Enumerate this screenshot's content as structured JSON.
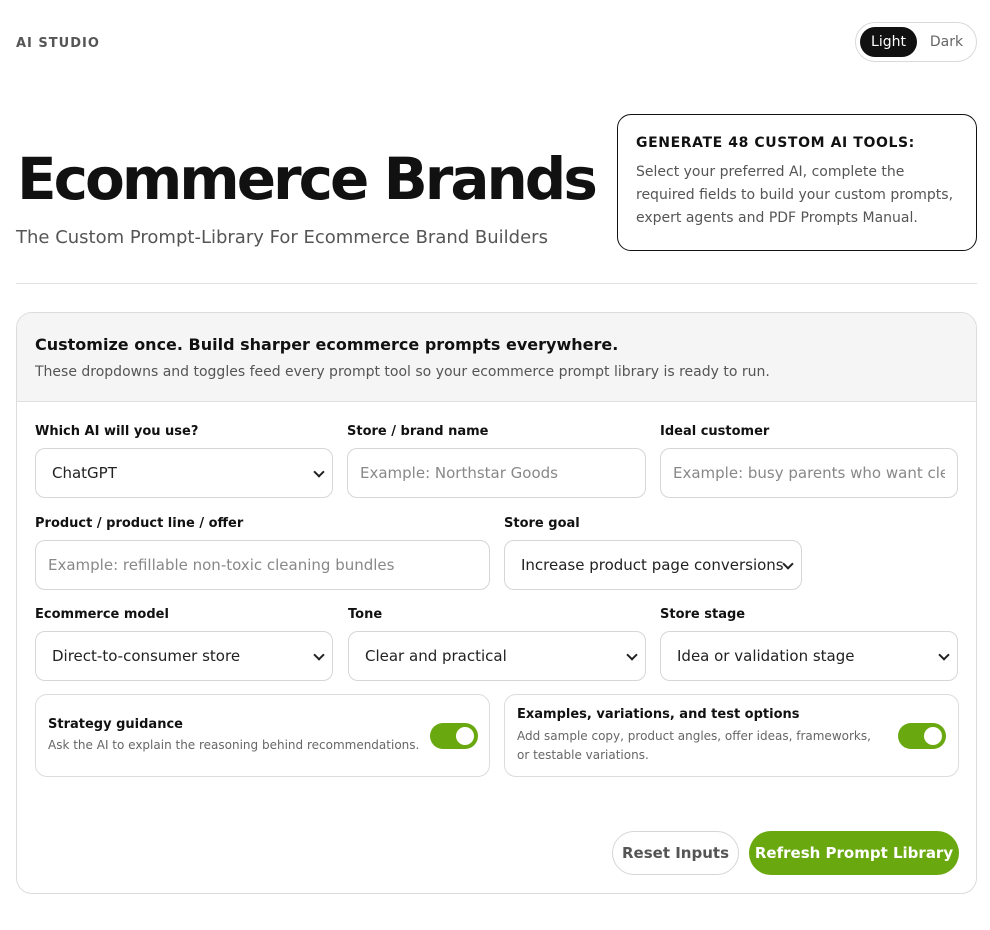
{
  "header": {
    "brand": "AI STUDIO",
    "theme": {
      "light_label": "Light",
      "dark_label": "Dark",
      "selected": "Light"
    }
  },
  "hero": {
    "title": "Ecommerce Brands",
    "subtitle": "The Custom Prompt-Library For Ecommerce Brand Builders"
  },
  "promo": {
    "heading": "GENERATE 48 CUSTOM AI TOOLS:",
    "body": "Select your preferred AI, complete the required fields to build your custom prompts, expert agents and PDF Prompts Manual."
  },
  "panel": {
    "title": "Customize once. Build sharper ecommerce prompts everywhere.",
    "description": "These dropdowns and toggles feed every prompt tool so your ecommerce prompt library is ready to run."
  },
  "form": {
    "ai": {
      "label": "Which AI will you use?",
      "value": "ChatGPT"
    },
    "store_name": {
      "label": "Store / brand name",
      "placeholder": "Example: Northstar Goods",
      "value": ""
    },
    "customer": {
      "label": "Ideal customer",
      "placeholder": "Example: busy parents who want clean",
      "value": ""
    },
    "product": {
      "label": "Product / product line / offer",
      "placeholder": "Example: refillable non-toxic cleaning bundles",
      "value": ""
    },
    "goal": {
      "label": "Store goal",
      "value": "Increase product page conversions"
    },
    "model": {
      "label": "Ecommerce model",
      "value": "Direct-to-consumer store"
    },
    "tone": {
      "label": "Tone",
      "value": "Clear and practical"
    },
    "stage": {
      "label": "Store stage",
      "value": "Idea or validation stage"
    }
  },
  "toggles": {
    "strategy": {
      "title": "Strategy guidance",
      "description": "Ask the AI to explain the reasoning behind recommendations.",
      "on": true
    },
    "examples": {
      "title": "Examples, variations, and test options",
      "description": "Add sample copy, product angles, offer ideas, frameworks, or testable variations.",
      "on": true
    }
  },
  "actions": {
    "reset_label": "Reset Inputs",
    "refresh_label": "Refresh Prompt Library"
  },
  "colors": {
    "accent": "#6aa80f",
    "dark": "#111111"
  }
}
